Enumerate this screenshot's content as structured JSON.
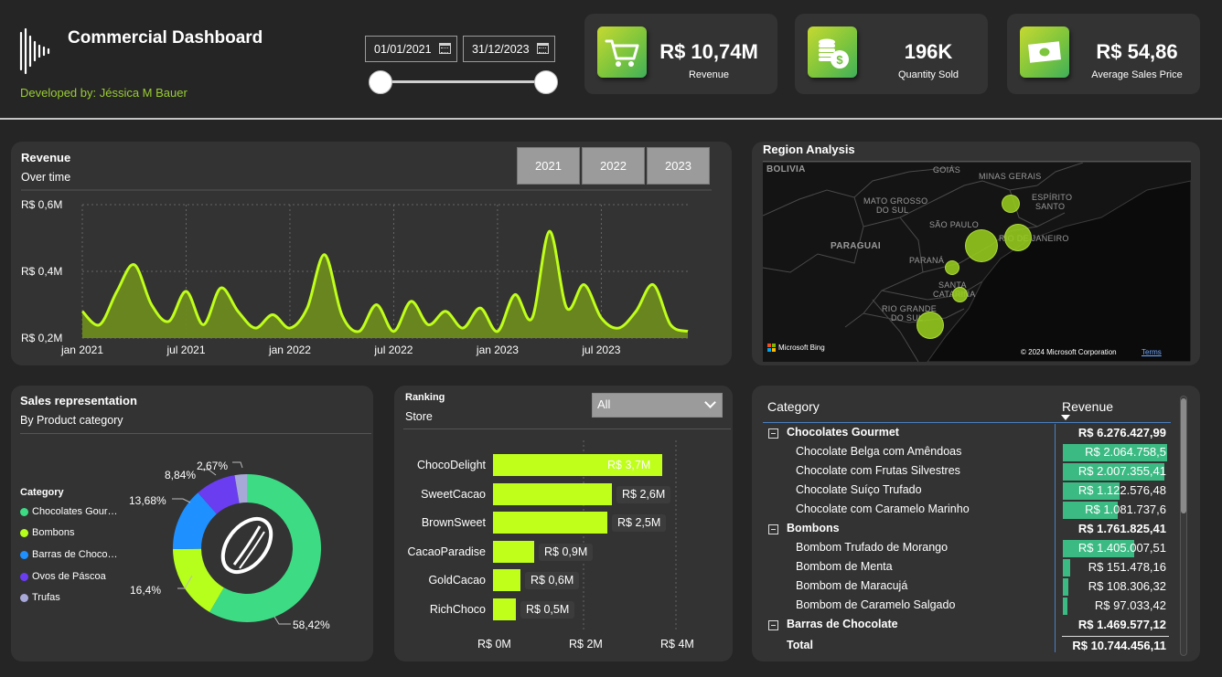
{
  "header": {
    "title": "Commercial Dashboard",
    "developer": "Developed by: Jéssica M Bauer",
    "date_start": "01/01/2021",
    "date_end": "31/12/2023",
    "logo_icon": "waveform-logo-icon"
  },
  "kpis": [
    {
      "value": "R$ 10,74M",
      "label": "Revenue",
      "icon": "shopping-cart-icon"
    },
    {
      "value": "196K",
      "label": "Quantity Sold",
      "icon": "coins-icon"
    },
    {
      "value": "R$ 54,86",
      "label": "Average Sales Price",
      "icon": "banknote-icon"
    }
  ],
  "revenue_chart": {
    "title": "Revenue",
    "subtitle": "Over time",
    "year_buttons": [
      "2021",
      "2022",
      "2023"
    ]
  },
  "region": {
    "title": "Region Analysis",
    "map_labels": [
      "BOLIVIA",
      "GOIÁS",
      "MINAS GERAIS",
      "ESPÍRITO",
      "SANTO",
      "MATO GROSSO",
      "DO SUL",
      "SÃO PAULO",
      "RIO DE JANEIRO",
      "PARAGUAI",
      "PARANÁ",
      "SANTA",
      "CATARINA",
      "RIO GRANDE",
      "DO SUL"
    ],
    "bing_credit": "Microsoft Bing",
    "copyright": "© 2024 Microsoft Corporation",
    "terms": "Terms"
  },
  "sales_rep": {
    "title": "Sales representation",
    "subtitle": "By Product category",
    "legend_title": "Category",
    "legend": [
      "Chocolates Gour…",
      "Bombons",
      "Barras de Choco…",
      "Ovos de Páscoa",
      "Trufas"
    ],
    "pct_labels": [
      "58,42%",
      "16,4%",
      "13,68%",
      "8,84%",
      "2,67%"
    ],
    "center_icon": "cocoa-bean-icon"
  },
  "ranking": {
    "title": "Ranking",
    "subtitle": "Store",
    "filter_value": "All",
    "stores": [
      "ChocoDelight",
      "SweetCacao",
      "BrownSweet",
      "CacaoParadise",
      "GoldCacao",
      "RichChoco"
    ],
    "labels": [
      "R$ 3,7M",
      "R$ 2,6M",
      "R$ 2,5M",
      "R$ 0,9M",
      "R$ 0,6M",
      "R$ 0,5M"
    ],
    "x_ticks": [
      "R$ 0M",
      "R$ 2M",
      "R$ 4M"
    ]
  },
  "matrix": {
    "col_category": "Category",
    "col_revenue": "Revenue",
    "rows": [
      {
        "label": "Chocolates Gourmet",
        "value": "R$ 6.276.427,99",
        "level": 0
      },
      {
        "label": "Chocolate Belga com Amêndoas",
        "value": "R$ 2.064.758,5",
        "level": 1
      },
      {
        "label": "Chocolate com Frutas Silvestres",
        "value": "R$ 2.007.355,41",
        "level": 1
      },
      {
        "label": "Chocolate Suíço Trufado",
        "value": "R$ 1.122.576,48",
        "level": 1
      },
      {
        "label": "Chocolate com Caramelo Marinho",
        "value": "R$ 1.081.737,6",
        "level": 1
      },
      {
        "label": "Bombons",
        "value": "R$ 1.761.825,41",
        "level": 0
      },
      {
        "label": "Bombom Trufado de Morango",
        "value": "R$ 1.405.007,51",
        "level": 1
      },
      {
        "label": "Bombom de Menta",
        "value": "R$ 151.478,16",
        "level": 1
      },
      {
        "label": "Bombom de Maracujá",
        "value": "R$ 108.306,32",
        "level": 1
      },
      {
        "label": "Bombom de Caramelo Salgado",
        "value": "R$ 97.033,42",
        "level": 1
      },
      {
        "label": "Barras de Chocolate",
        "value": "R$ 1.469.577,12",
        "level": 0
      }
    ],
    "total_label": "Total",
    "total_value": "R$ 10.744.456,11"
  },
  "colors": {
    "accent": "#bfff1a",
    "area_fill": "#6b8a1f",
    "donut": [
      "#3ddc84",
      "#b6ff1c",
      "#1e90ff",
      "#6a3df0",
      "#a8a8d8"
    ],
    "matrix_bar": "#3cba83"
  },
  "chart_data": [
    {
      "type": "area",
      "title": "Revenue",
      "subtitle": "Over time",
      "x_ticks": [
        "jan 2021",
        "jul 2021",
        "jan 2022",
        "jul 2022",
        "jan 2023",
        "jul 2023"
      ],
      "y_ticks": [
        "R$ 0,2M",
        "R$ 0,4M",
        "R$ 0,6M"
      ],
      "ylim": [
        0.2,
        0.6
      ],
      "x": [
        "2021-01",
        "2021-02",
        "2021-03",
        "2021-04",
        "2021-05",
        "2021-06",
        "2021-07",
        "2021-08",
        "2021-09",
        "2021-10",
        "2021-11",
        "2021-12",
        "2022-01",
        "2022-02",
        "2022-03",
        "2022-04",
        "2022-05",
        "2022-06",
        "2022-07",
        "2022-08",
        "2022-09",
        "2022-10",
        "2022-11",
        "2022-12",
        "2023-01",
        "2023-02",
        "2023-03",
        "2023-04",
        "2023-05",
        "2023-06",
        "2023-07",
        "2023-08",
        "2023-09",
        "2023-10",
        "2023-11",
        "2023-12"
      ],
      "values": [
        0.28,
        0.24,
        0.34,
        0.42,
        0.3,
        0.25,
        0.34,
        0.24,
        0.35,
        0.28,
        0.23,
        0.27,
        0.23,
        0.29,
        0.45,
        0.27,
        0.22,
        0.3,
        0.22,
        0.31,
        0.24,
        0.28,
        0.23,
        0.29,
        0.22,
        0.33,
        0.26,
        0.52,
        0.29,
        0.36,
        0.26,
        0.23,
        0.28,
        0.36,
        0.24,
        0.22
      ]
    },
    {
      "type": "pie",
      "title": "Sales representation",
      "categories": [
        "Chocolates Gourmet",
        "Bombons",
        "Barras de Chocolate",
        "Ovos de Páscoa",
        "Trufas"
      ],
      "values": [
        58.42,
        16.4,
        13.68,
        8.84,
        2.67
      ]
    },
    {
      "type": "bar",
      "title": "Ranking",
      "categories": [
        "ChocoDelight",
        "SweetCacao",
        "BrownSweet",
        "CacaoParadise",
        "GoldCacao",
        "RichChoco"
      ],
      "values": [
        3.7,
        2.6,
        2.5,
        0.9,
        0.6,
        0.5
      ],
      "xlim": [
        0,
        4
      ]
    },
    {
      "type": "scatter",
      "title": "Region Analysis",
      "points": [
        {
          "region": "Minas Gerais",
          "size": 0.55
        },
        {
          "region": "Rio de Janeiro",
          "size": 0.85
        },
        {
          "region": "São Paulo",
          "size": 1.0
        },
        {
          "region": "Paraná",
          "size": 0.45
        },
        {
          "region": "Santa Catarina",
          "size": 0.45
        },
        {
          "region": "Rio Grande do Sul",
          "size": 0.75
        }
      ]
    }
  ]
}
